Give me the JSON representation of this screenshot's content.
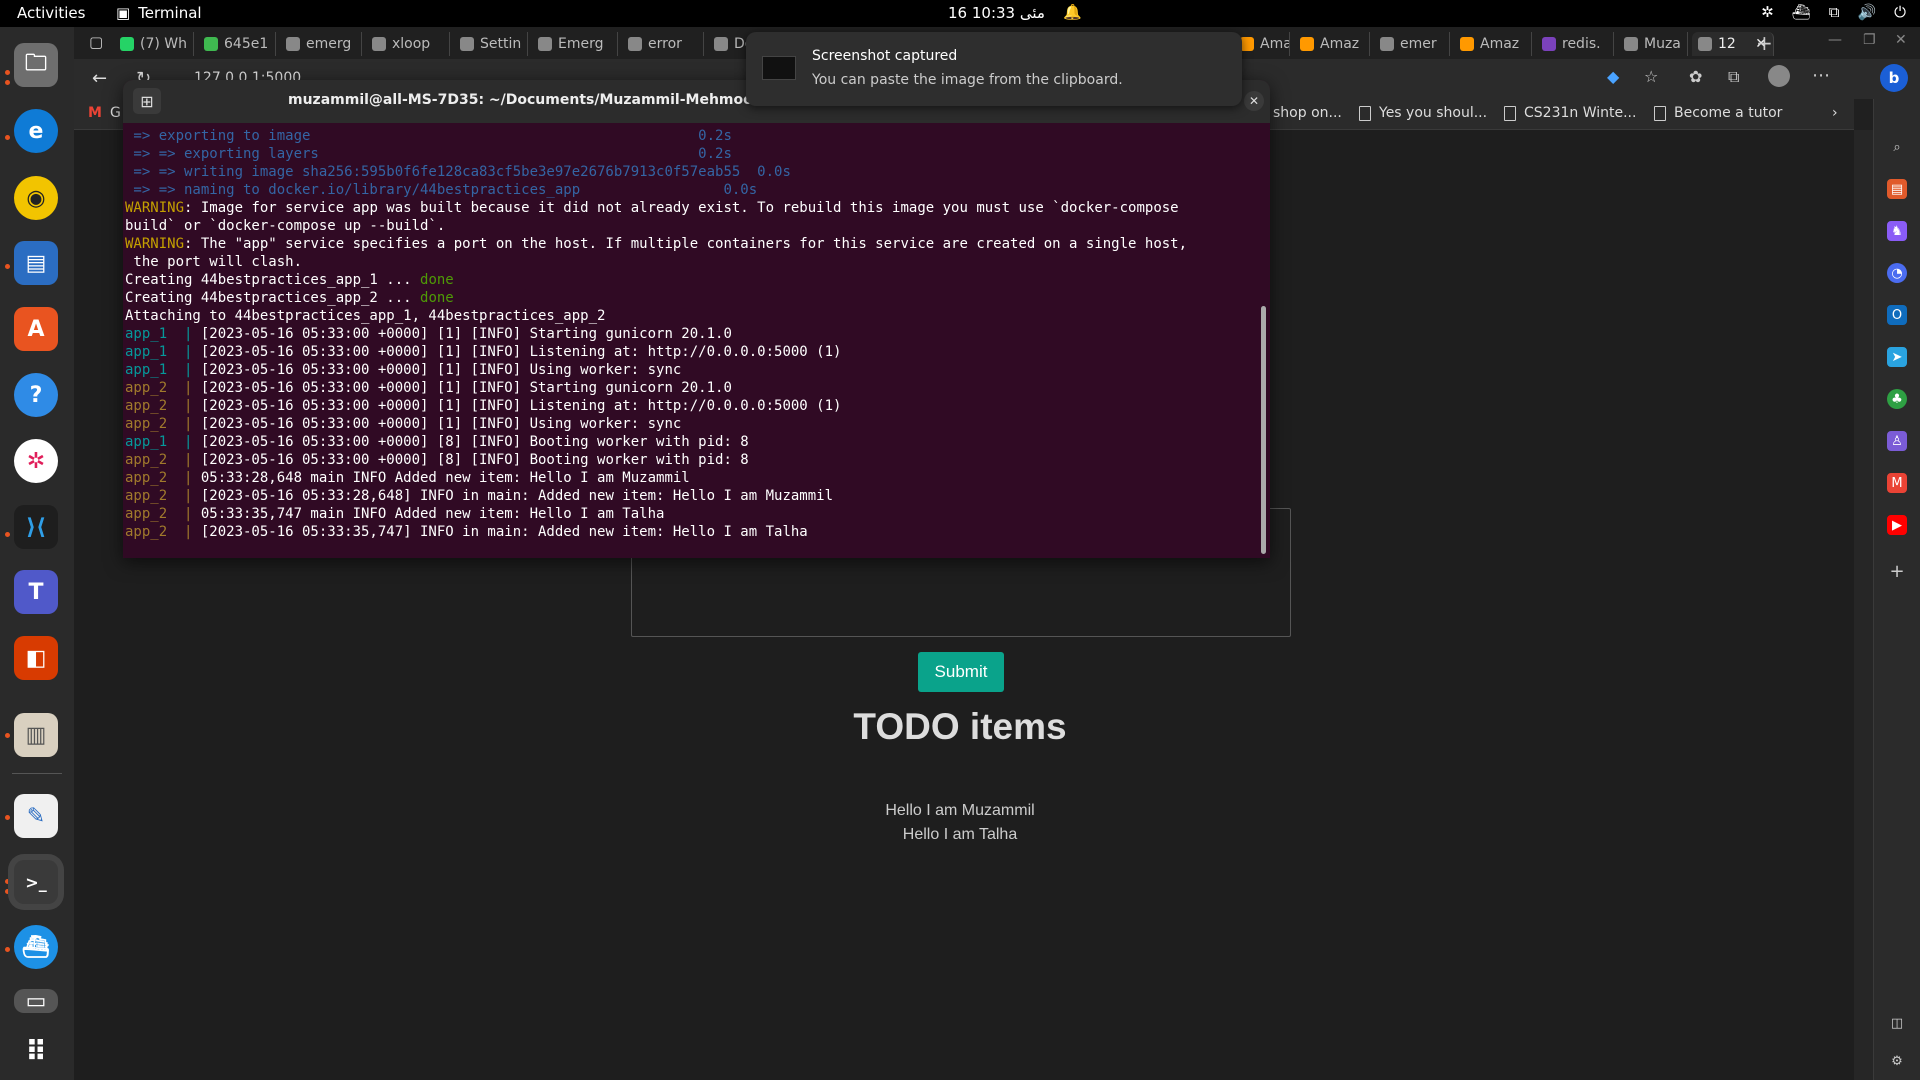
{
  "topbar": {
    "activities": "Activities",
    "app_name": "Terminal",
    "clock": "16 مئی 10:33"
  },
  "tabs": [
    {
      "label": "(7) Wh",
      "color": "#25d366"
    },
    {
      "label": "645e1",
      "color": "#3fb950"
    },
    {
      "label": "emerg",
      "color": "#888888"
    },
    {
      "label": "xloop",
      "color": "#888888"
    },
    {
      "label": "Settin",
      "color": "#888888"
    },
    {
      "label": "Emerg",
      "color": "#888888"
    },
    {
      "label": "error",
      "color": "#888888"
    },
    {
      "label": "Docur",
      "color": "#888888"
    },
    {
      "label": "Amaz",
      "color": "#ff9900"
    },
    {
      "label": "Amaz",
      "color": "#ff9900"
    },
    {
      "label": "emer",
      "color": "#888888"
    },
    {
      "label": "Amaz",
      "color": "#ff9900"
    },
    {
      "label": "redis.",
      "color": "#7b42bc"
    },
    {
      "label": "Muza",
      "color": "#888888"
    },
    {
      "label": "12",
      "color": "#888888"
    }
  ],
  "address": "127.0.0.1:5000",
  "bookmarks": [
    {
      "label": "G"
    },
    {
      "label": "shop on..."
    },
    {
      "label": "Yes you shoul..."
    },
    {
      "label": "CS231n Winte..."
    },
    {
      "label": "Become a tutor"
    }
  ],
  "page": {
    "submit_label": "Submit",
    "todo_title": "TODO items",
    "items": [
      "Hello I am Muzammil",
      "Hello I am Talha"
    ]
  },
  "terminal": {
    "title": "muzammil@all-MS-7D35: ~/Documents/Muzammil-Mehmood-230...",
    "lines": [
      {
        "segs": [
          {
            "t": " => exporting to image                                              0.2s",
            "c": "c-blue"
          }
        ]
      },
      {
        "segs": [
          {
            "t": " => => exporting layers                                             0.2s",
            "c": "c-blue"
          }
        ]
      },
      {
        "segs": [
          {
            "t": " => => writing image sha256:595b0f6fe128ca83cf5be3e97e2676b7913c0f57eab55  0.0s",
            "c": "c-blue"
          }
        ]
      },
      {
        "segs": [
          {
            "t": " => => naming to docker.io/library/44bestpractices_app                 0.0s",
            "c": "c-blue"
          }
        ]
      },
      {
        "segs": [
          {
            "t": "WARNING",
            "c": "c-warn"
          },
          {
            "t": ": Image for service app was built because it did not already exist. To rebuild this image you must use `docker-compose",
            "c": ""
          }
        ]
      },
      {
        "segs": [
          {
            "t": "build` or `docker-compose up --build`.",
            "c": ""
          }
        ]
      },
      {
        "segs": [
          {
            "t": "WARNING",
            "c": "c-warn"
          },
          {
            "t": ": The \"app\" service specifies a port on the host. If multiple containers for this service are created on a single host,",
            "c": ""
          }
        ]
      },
      {
        "segs": [
          {
            "t": " the port will clash.",
            "c": ""
          }
        ]
      },
      {
        "segs": [
          {
            "t": "Creating 44bestpractices_app_1 ... ",
            "c": ""
          },
          {
            "t": "done",
            "c": "c-green"
          }
        ]
      },
      {
        "segs": [
          {
            "t": "Creating 44bestpractices_app_2 ... ",
            "c": ""
          },
          {
            "t": "done",
            "c": "c-green"
          }
        ]
      },
      {
        "segs": [
          {
            "t": "Attaching to 44bestpractices_app_1, 44bestpractices_app_2",
            "c": ""
          }
        ]
      },
      {
        "segs": [
          {
            "t": "app_1  | ",
            "c": "c-cyan"
          },
          {
            "t": "[2023-05-16 05:33:00 +0000] [1] [INFO] Starting gunicorn 20.1.0",
            "c": ""
          }
        ]
      },
      {
        "segs": [
          {
            "t": "app_1  | ",
            "c": "c-cyan"
          },
          {
            "t": "[2023-05-16 05:33:00 +0000] [1] [INFO] Listening at: http://0.0.0.0:5000 (1)",
            "c": ""
          }
        ]
      },
      {
        "segs": [
          {
            "t": "app_1  | ",
            "c": "c-cyan"
          },
          {
            "t": "[2023-05-16 05:33:00 +0000] [1] [INFO] Using worker: sync",
            "c": ""
          }
        ]
      },
      {
        "segs": [
          {
            "t": "app_2  | ",
            "c": "c-brown"
          },
          {
            "t": "[2023-05-16 05:33:00 +0000] [1] [INFO] Starting gunicorn 20.1.0",
            "c": ""
          }
        ]
      },
      {
        "segs": [
          {
            "t": "app_2  | ",
            "c": "c-brown"
          },
          {
            "t": "[2023-05-16 05:33:00 +0000] [1] [INFO] Listening at: http://0.0.0.0:5000 (1)",
            "c": ""
          }
        ]
      },
      {
        "segs": [
          {
            "t": "app_2  | ",
            "c": "c-brown"
          },
          {
            "t": "[2023-05-16 05:33:00 +0000] [1] [INFO] Using worker: sync",
            "c": ""
          }
        ]
      },
      {
        "segs": [
          {
            "t": "app_1  | ",
            "c": "c-cyan"
          },
          {
            "t": "[2023-05-16 05:33:00 +0000] [8] [INFO] Booting worker with pid: 8",
            "c": ""
          }
        ]
      },
      {
        "segs": [
          {
            "t": "app_2  | ",
            "c": "c-brown"
          },
          {
            "t": "[2023-05-16 05:33:00 +0000] [8] [INFO] Booting worker with pid: 8",
            "c": ""
          }
        ]
      },
      {
        "segs": [
          {
            "t": "app_2  | ",
            "c": "c-brown"
          },
          {
            "t": "05:33:28,648 main INFO Added new item: Hello I am Muzammil",
            "c": ""
          }
        ]
      },
      {
        "segs": [
          {
            "t": "app_2  | ",
            "c": "c-brown"
          },
          {
            "t": "[2023-05-16 05:33:28,648] INFO in main: Added new item: Hello I am Muzammil",
            "c": ""
          }
        ]
      },
      {
        "segs": [
          {
            "t": "app_2  | ",
            "c": "c-brown"
          },
          {
            "t": "05:33:35,747 main INFO Added new item: Hello I am Talha",
            "c": ""
          }
        ]
      },
      {
        "segs": [
          {
            "t": "app_2  | ",
            "c": "c-brown"
          },
          {
            "t": "[2023-05-16 05:33:35,747] INFO in main: Added new item: Hello I am Talha",
            "c": ""
          }
        ]
      }
    ]
  },
  "notification": {
    "title": "Screenshot captured",
    "body": "You can paste the image from the clipboard."
  },
  "colors": {
    "accent": "#0aa38b",
    "terminal_bg": "#300a24",
    "ubuntu_orange": "#e95420"
  }
}
